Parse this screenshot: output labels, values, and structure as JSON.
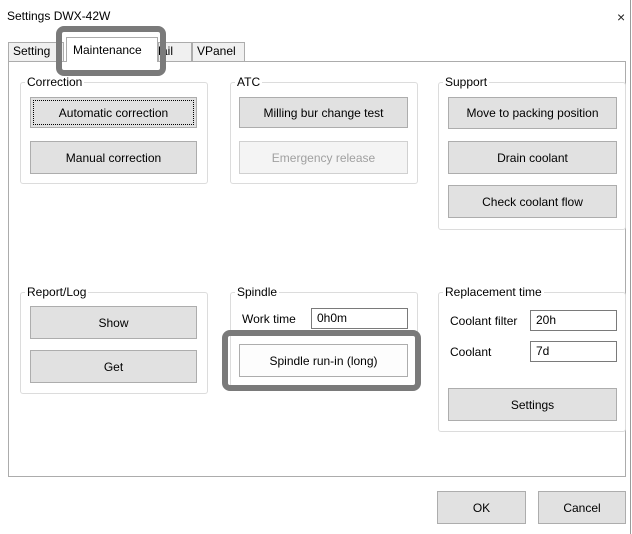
{
  "window": {
    "title": "Settings DWX-42W",
    "close_glyph": "×"
  },
  "tabs": [
    {
      "label": "Setting"
    },
    {
      "label": "Maintenance"
    },
    {
      "label": "Mail"
    },
    {
      "label": "VPanel"
    }
  ],
  "correction": {
    "title": "Correction",
    "automatic": "Automatic correction",
    "manual": "Manual correction"
  },
  "atc": {
    "title": "ATC",
    "milling_test": "Milling bur change test",
    "emergency": "Emergency release"
  },
  "support": {
    "title": "Support",
    "move": "Move to packing position",
    "drain": "Drain coolant",
    "check": "Check coolant flow"
  },
  "report": {
    "title": "Report/Log",
    "show": "Show",
    "get": "Get"
  },
  "spindle": {
    "title": "Spindle",
    "work_time_label": "Work time",
    "work_time_value": "0h0m",
    "runin": "Spindle run-in (long)"
  },
  "replacement": {
    "title": "Replacement time",
    "filter_label": "Coolant filter",
    "filter_value": "20h",
    "coolant_label": "Coolant",
    "coolant_value": "7d",
    "settings": "Settings"
  },
  "footer": {
    "ok": "OK",
    "cancel": "Cancel"
  }
}
